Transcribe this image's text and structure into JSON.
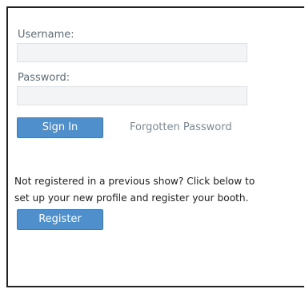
{
  "login_form": {
    "username_label": "Username:",
    "username_value": "",
    "password_label": "Password:",
    "password_value": "",
    "signin_label": "Sign In",
    "forgot_label": "Forgotten Password"
  },
  "registration": {
    "prompt_line1": "Not registered in a previous show? Click below to",
    "prompt_line2": "set up your new profile and register your booth.",
    "register_label": "Register"
  },
  "colors": {
    "button_bg": "#4f8fcb",
    "label_text": "#5f6d78",
    "link_text": "#7b8a95",
    "field_bg": "#f3f4f5",
    "frame_border": "#222222"
  }
}
